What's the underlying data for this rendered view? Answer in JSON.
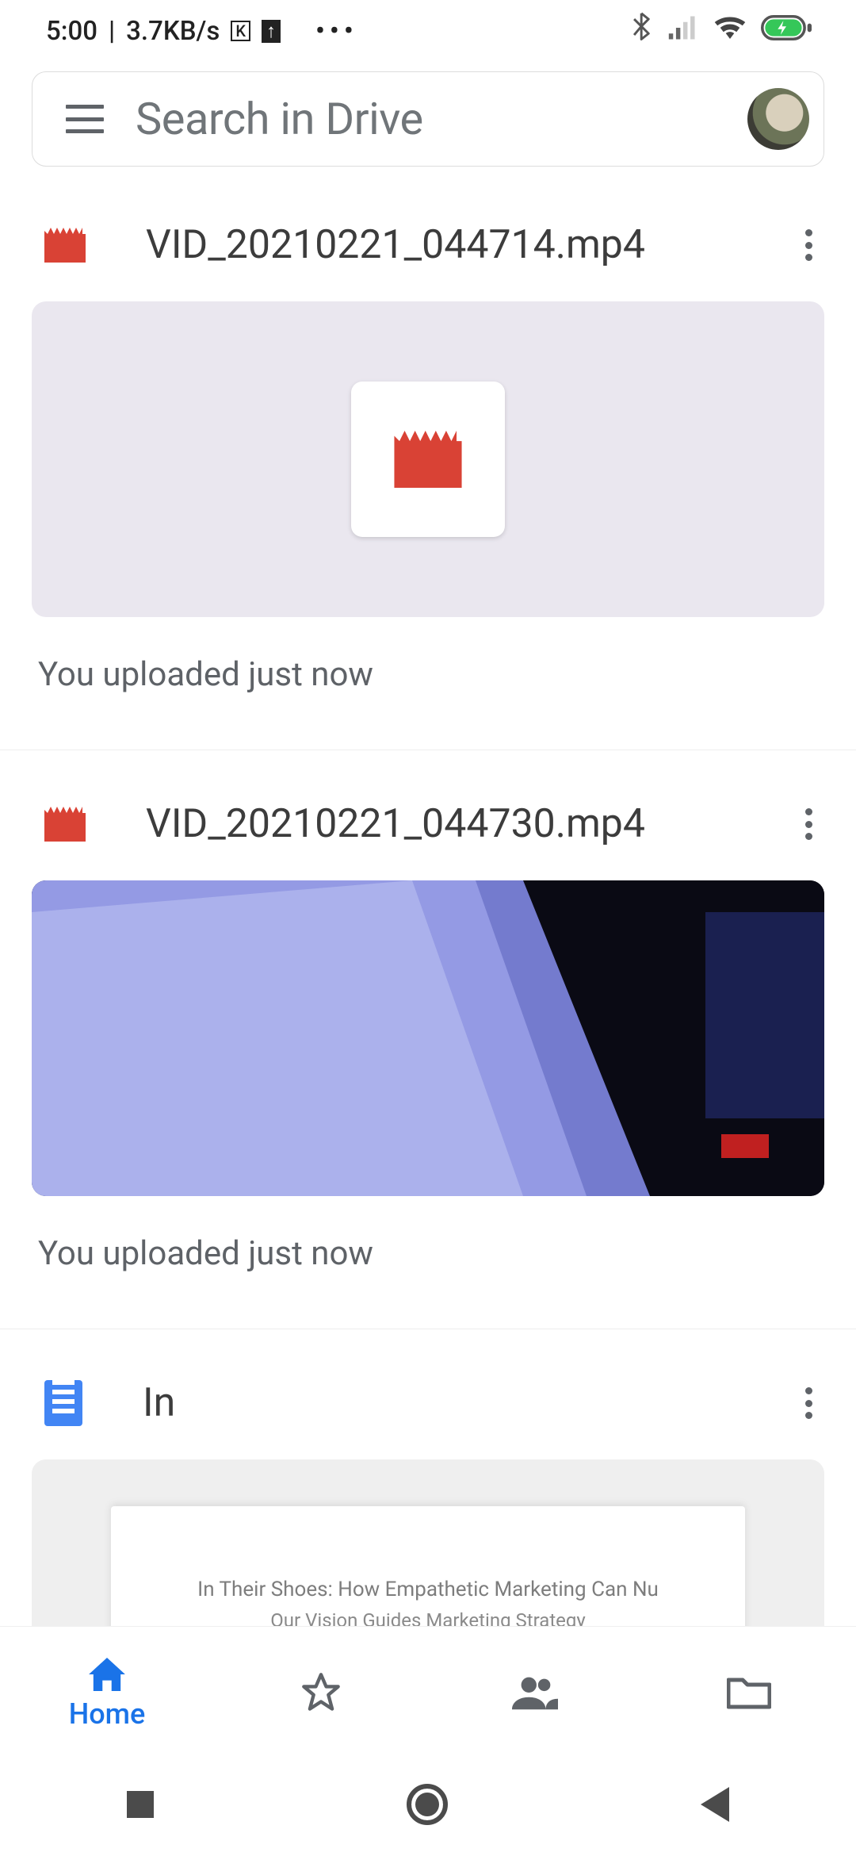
{
  "status_bar": {
    "time": "5:00",
    "separator": " | ",
    "net_speed": "3.7KB/s",
    "icons": {
      "k_box": "K",
      "upload": "↑",
      "dots": "⋯",
      "bluetooth": "bt",
      "signal": "sig",
      "wifi": "wifi",
      "battery": "bat"
    }
  },
  "search": {
    "placeholder": "Search in Drive"
  },
  "files": [
    {
      "name": "VID_20210221_044714.mp4",
      "type": "video",
      "status": "You uploaded just now",
      "has_preview": false
    },
    {
      "name": "VID_20210221_044730.mp4",
      "type": "video",
      "status": "You uploaded just now",
      "has_preview": true
    },
    {
      "name": "In",
      "type": "doc",
      "status": "",
      "has_preview": true,
      "doc_line1": "In Their Shoes: How Empathetic Marketing Can Nu",
      "doc_line2": "Our Vision Guides Marketing Strategy"
    }
  ],
  "bottom_nav": {
    "home": "Home"
  }
}
